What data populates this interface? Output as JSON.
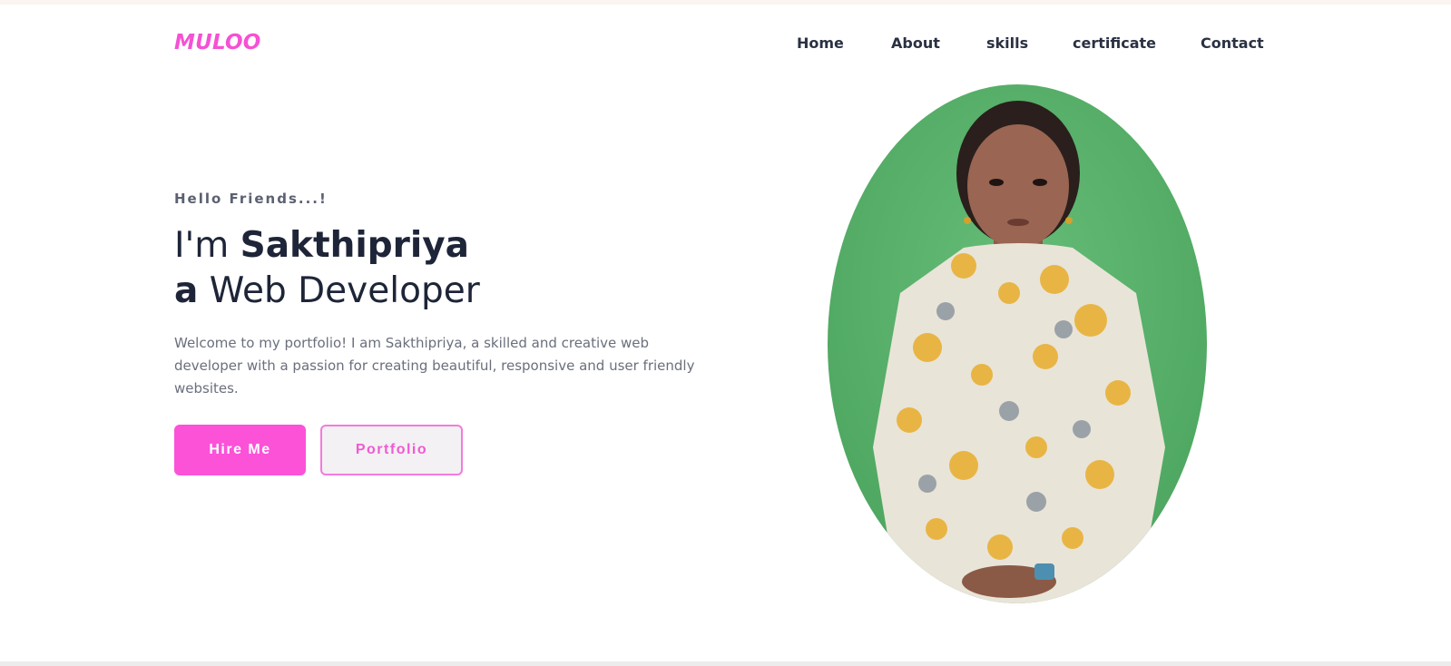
{
  "brand": {
    "logo": "MULOO",
    "accent_color": "#f551d4"
  },
  "nav": {
    "items": [
      "Home",
      "About",
      "skills",
      "certificate",
      "Contact"
    ]
  },
  "hero": {
    "greeting": "Hello Friends...!",
    "line1_prefix": "I'm ",
    "name": "Sakthipriya",
    "line2_article": "a",
    "line2_role": " Web Developer",
    "intro": "Welcome to my portfolio! I am Sakthipriya, a skilled and creative web developer with a passion for creating beautiful, responsive and user friendly websites."
  },
  "buttons": {
    "hire": "Hire Me",
    "portfolio": "Portfolio"
  },
  "portrait": {
    "background_color": "#56b168",
    "outfit_color": "#e9e4d8"
  }
}
